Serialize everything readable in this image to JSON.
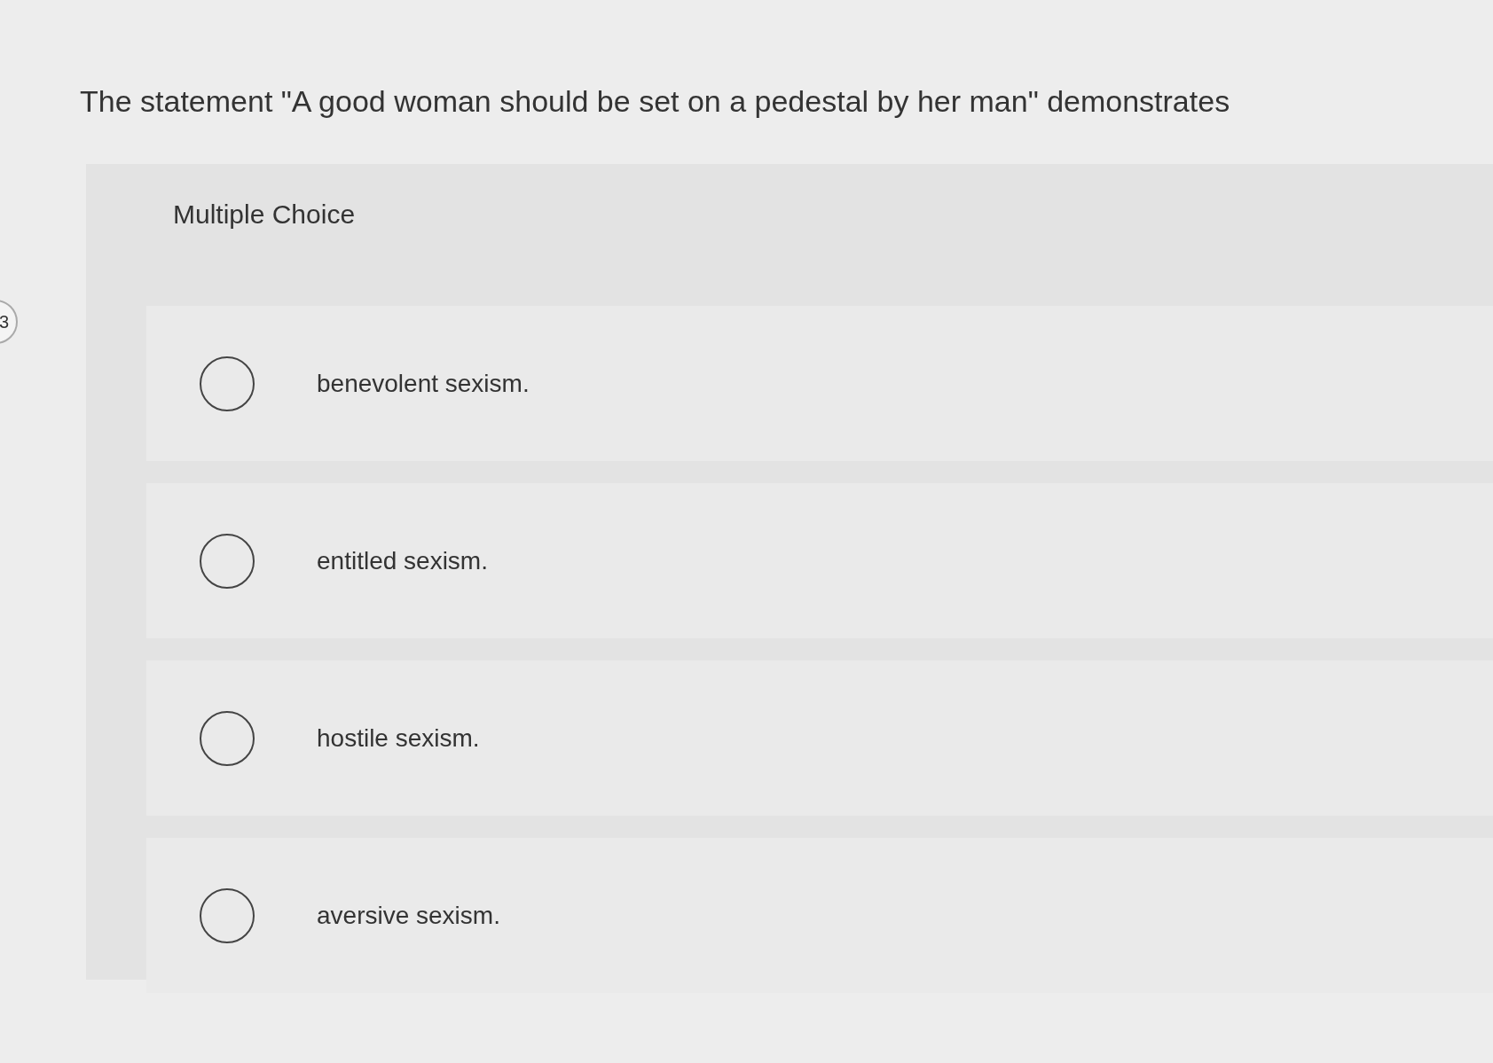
{
  "question_number": "3",
  "question": "The statement \"A good woman should be set on a pedestal by her man\" demonstrates",
  "answer_panel": {
    "heading": "Multiple Choice",
    "options": [
      {
        "label": "benevolent sexism.",
        "selected": false
      },
      {
        "label": "entitled sexism.",
        "selected": false
      },
      {
        "label": "hostile sexism.",
        "selected": false
      },
      {
        "label": "aversive sexism.",
        "selected": false
      }
    ]
  }
}
